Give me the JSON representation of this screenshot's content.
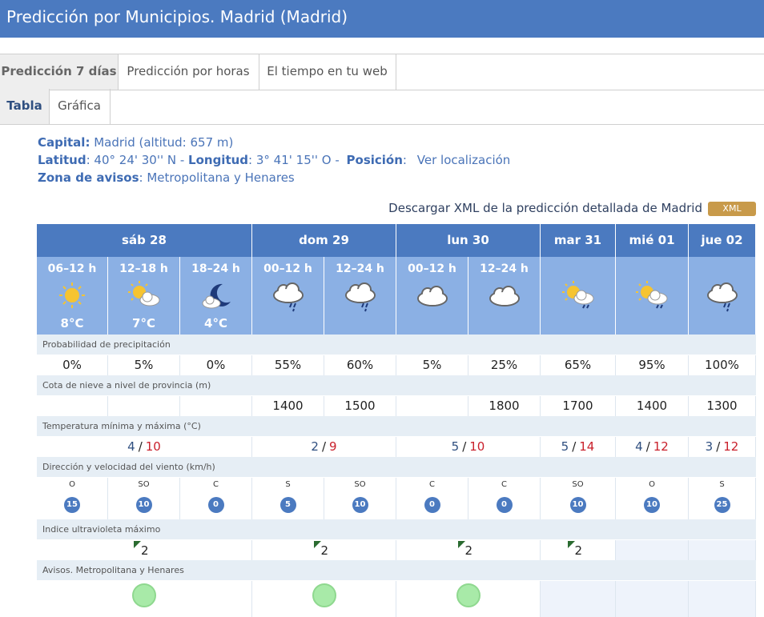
{
  "header": {
    "title": "Predicción por Municipios. Madrid (Madrid)"
  },
  "tabs": [
    {
      "label": "Predicción 7 días"
    },
    {
      "label": "Predicción por horas"
    },
    {
      "label": "El tiempo en tu web"
    }
  ],
  "subtabs": [
    {
      "label": "Tabla"
    },
    {
      "label": "Gráfica"
    }
  ],
  "info": {
    "capital_label": "Capital:",
    "capital_value": " Madrid (altitud: 657 m)",
    "latitud_label": "Latitud",
    "latitud_value": ": 40° 24' 30'' N - ",
    "longitud_label": "Longitud",
    "longitud_value": ": 3° 41' 15'' O - ",
    "posicion_label": "Posición",
    "posicion_colon": ":",
    "posicion_link": "Ver localización",
    "zona_label": "Zona de avisos",
    "zona_value": ": Metropolitana y Henares"
  },
  "xml": {
    "text": "Descargar XML de la predicción detallada de Madrid",
    "button": "XML"
  },
  "days": [
    {
      "label": "sáb 28"
    },
    {
      "label": "dom 29"
    },
    {
      "label": "lun 30"
    },
    {
      "label": "mar 31"
    },
    {
      "label": "mié 01"
    },
    {
      "label": "jue 02"
    }
  ],
  "slots": [
    {
      "label": "06–12 h",
      "icon": "sun-icon",
      "temp": "8°C"
    },
    {
      "label": "12–18 h",
      "icon": "sun-cloud-icon",
      "temp": "7°C"
    },
    {
      "label": "18–24 h",
      "icon": "moon-cloud-icon",
      "temp": "4°C"
    },
    {
      "label": "00–12 h",
      "icon": "cloud-rain-icon",
      "temp": ""
    },
    {
      "label": "12–24 h",
      "icon": "cloud-rain-icon",
      "temp": ""
    },
    {
      "label": "00–12 h",
      "icon": "cloud-icon",
      "temp": ""
    },
    {
      "label": "12–24 h",
      "icon": "cloud-icon",
      "temp": ""
    },
    {
      "label": "",
      "icon": "sun-cloud-rain-icon",
      "temp": ""
    },
    {
      "label": "",
      "icon": "sun-cloud-rain-icon",
      "temp": ""
    },
    {
      "label": "",
      "icon": "cloud-rain-icon",
      "temp": ""
    }
  ],
  "sections": {
    "precip": "Probabilidad de precipitación",
    "snow": "Cota de nieve a nivel de provincia (m)",
    "temp": "Temperatura mínima y máxima (°C)",
    "wind": "Dirección y velocidad del viento (km/h)",
    "uv": "Indice ultravioleta máximo",
    "avisos": "Avisos. Metropolitana y Henares"
  },
  "precip": [
    "0%",
    "5%",
    "0%",
    "55%",
    "60%",
    "5%",
    "25%",
    "65%",
    "95%",
    "100%"
  ],
  "snow": [
    "",
    "",
    "",
    "1400",
    "1500",
    "",
    "1800",
    "1700",
    "1400",
    "1300"
  ],
  "temps": [
    {
      "min": "4",
      "max": "10"
    },
    {
      "min": "2",
      "max": "9"
    },
    {
      "min": "5",
      "max": "10"
    },
    {
      "min": "5",
      "max": "14"
    },
    {
      "min": "4",
      "max": "12"
    },
    {
      "min": "3",
      "max": "12"
    }
  ],
  "wind": [
    {
      "dir": "O",
      "speed": "15"
    },
    {
      "dir": "SO",
      "speed": "10"
    },
    {
      "dir": "C",
      "speed": "0"
    },
    {
      "dir": "S",
      "speed": "5"
    },
    {
      "dir": "SO",
      "speed": "10"
    },
    {
      "dir": "C",
      "speed": "0"
    },
    {
      "dir": "C",
      "speed": "0"
    },
    {
      "dir": "SO",
      "speed": "10"
    },
    {
      "dir": "O",
      "speed": "10"
    },
    {
      "dir": "S",
      "speed": "25"
    }
  ],
  "uv": [
    "2",
    "2",
    "2",
    "2",
    "",
    ""
  ],
  "slash": "/"
}
